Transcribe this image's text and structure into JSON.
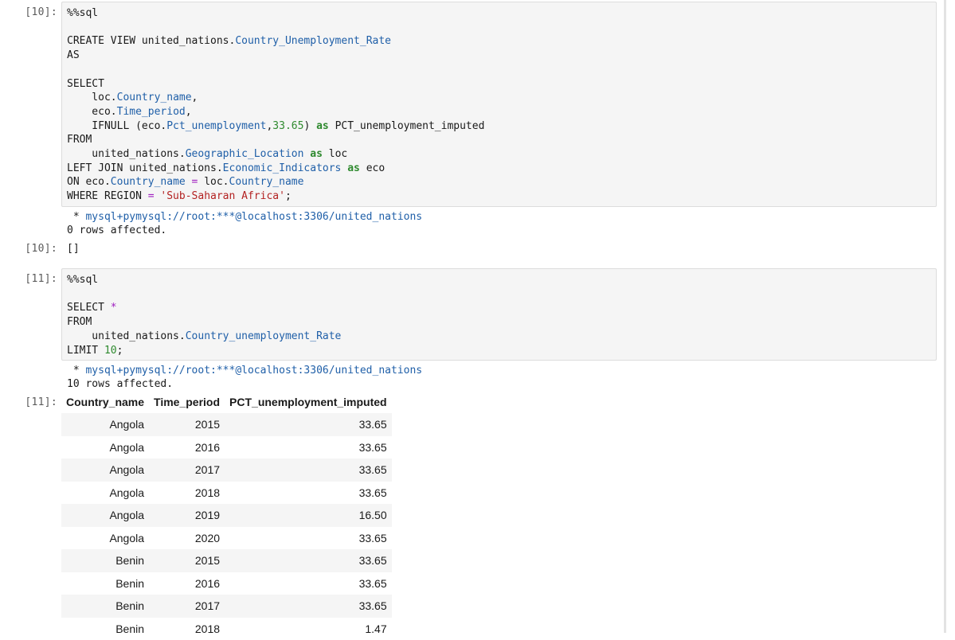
{
  "cells": [
    {
      "prompt_in": "[10]:",
      "code_lines": [
        [
          {
            "t": "%%sql",
            "c": "k"
          }
        ],
        [],
        [
          {
            "t": "CREATE VIEW united_nations.",
            "c": "k"
          },
          {
            "t": "Country_Unemployment_Rate",
            "c": "b"
          }
        ],
        [
          {
            "t": "AS",
            "c": "k"
          }
        ],
        [],
        [
          {
            "t": "SELECT",
            "c": "k"
          }
        ],
        [
          {
            "t": "    loc.",
            "c": "k"
          },
          {
            "t": "Country_name",
            "c": "b"
          },
          {
            "t": ",",
            "c": "k"
          }
        ],
        [
          {
            "t": "    eco.",
            "c": "k"
          },
          {
            "t": "Time_period",
            "c": "b"
          },
          {
            "t": ",",
            "c": "k"
          }
        ],
        [
          {
            "t": "    IFNULL (eco.",
            "c": "k"
          },
          {
            "t": "Pct_unemployment",
            "c": "b"
          },
          {
            "t": ",",
            "c": "k"
          },
          {
            "t": "33.65",
            "c": "n"
          },
          {
            "t": ") ",
            "c": "k"
          },
          {
            "t": "as",
            "c": "g"
          },
          {
            "t": " PCT_unemployment_imputed",
            "c": "k"
          }
        ],
        [
          {
            "t": "FROM",
            "c": "k"
          }
        ],
        [
          {
            "t": "    united_nations.",
            "c": "k"
          },
          {
            "t": "Geographic_Location",
            "c": "b"
          },
          {
            "t": " ",
            "c": "k"
          },
          {
            "t": "as",
            "c": "g"
          },
          {
            "t": " loc",
            "c": "k"
          }
        ],
        [
          {
            "t": "LEFT JOIN united_nations.",
            "c": "k"
          },
          {
            "t": "Economic_Indicators",
            "c": "b"
          },
          {
            "t": " ",
            "c": "k"
          },
          {
            "t": "as",
            "c": "g"
          },
          {
            "t": " eco",
            "c": "k"
          }
        ],
        [
          {
            "t": "ON eco.",
            "c": "k"
          },
          {
            "t": "Country_name",
            "c": "b"
          },
          {
            "t": " ",
            "c": "k"
          },
          {
            "t": "=",
            "c": "p"
          },
          {
            "t": " loc.",
            "c": "k"
          },
          {
            "t": "Country_name",
            "c": "b"
          }
        ],
        [
          {
            "t": "WHERE REGION ",
            "c": "k"
          },
          {
            "t": "=",
            "c": "p"
          },
          {
            "t": " ",
            "c": "k"
          },
          {
            "t": "'Sub-Saharan Africa'",
            "c": "s"
          },
          {
            "t": ";",
            "c": "k"
          }
        ]
      ],
      "stream_connection": "mysql+pymysql://root:***@localhost:3306/united_nations",
      "stream_bullet": " * ",
      "stream_rows": "0 rows affected.",
      "prompt_out": "[10]:",
      "output_text": "[]"
    },
    {
      "prompt_in": "[11]:",
      "code_lines": [
        [
          {
            "t": "%%sql",
            "c": "k"
          }
        ],
        [],
        [
          {
            "t": "SELECT ",
            "c": "k"
          },
          {
            "t": "*",
            "c": "p"
          }
        ],
        [
          {
            "t": "FROM",
            "c": "k"
          }
        ],
        [
          {
            "t": "    united_nations.",
            "c": "k"
          },
          {
            "t": "Country_unemployment_Rate",
            "c": "b"
          }
        ],
        [
          {
            "t": "LIMIT ",
            "c": "k"
          },
          {
            "t": "10",
            "c": "n"
          },
          {
            "t": ";",
            "c": "k"
          }
        ]
      ],
      "stream_connection": "mysql+pymysql://root:***@localhost:3306/united_nations",
      "stream_bullet": " * ",
      "stream_rows": "10 rows affected.",
      "prompt_out": "[11]:",
      "table": {
        "columns": [
          "Country_name",
          "Time_period",
          "PCT_unemployment_imputed"
        ],
        "rows": [
          [
            "Angola",
            "2015",
            "33.65"
          ],
          [
            "Angola",
            "2016",
            "33.65"
          ],
          [
            "Angola",
            "2017",
            "33.65"
          ],
          [
            "Angola",
            "2018",
            "33.65"
          ],
          [
            "Angola",
            "2019",
            "16.50"
          ],
          [
            "Angola",
            "2020",
            "33.65"
          ],
          [
            "Benin",
            "2015",
            "33.65"
          ],
          [
            "Benin",
            "2016",
            "33.65"
          ],
          [
            "Benin",
            "2017",
            "33.65"
          ],
          [
            "Benin",
            "2018",
            "1.47"
          ]
        ]
      }
    }
  ],
  "colors": {
    "code_background": "#f5f5f5",
    "keyword_blue": "#1f5fa8",
    "number_green": "#2f8a2f",
    "operator_purple": "#a020c0",
    "string_red": "#b32222"
  }
}
